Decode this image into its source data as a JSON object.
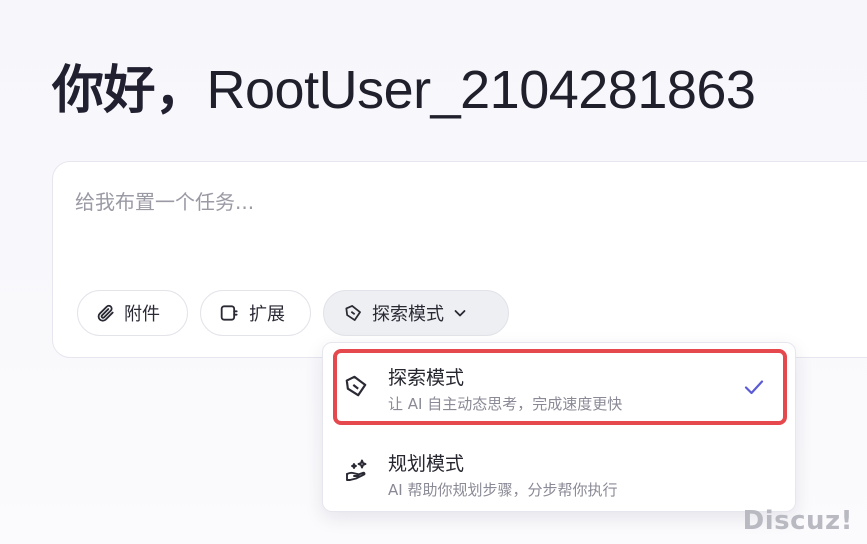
{
  "greeting": {
    "prefix": "你好，",
    "username": "RootUser_2104281863"
  },
  "composer": {
    "placeholder": "给我布置一个任务...",
    "toolbar": {
      "attach_label": "附件",
      "extend_label": "扩展",
      "mode_label": "探索模式"
    }
  },
  "mode_menu": {
    "options": [
      {
        "title": "探索模式",
        "description": "让 AI 自主动态思考，完成速度更快",
        "selected": true,
        "icon": "explore-tag-icon"
      },
      {
        "title": "规划模式",
        "description": "AI 帮助你规划步骤，分步帮你执行",
        "selected": false,
        "icon": "sparkle-hand-icon"
      }
    ],
    "highlight_color": "#e5484d",
    "check_color": "#5b5bd6"
  },
  "watermark": "Discuz!"
}
